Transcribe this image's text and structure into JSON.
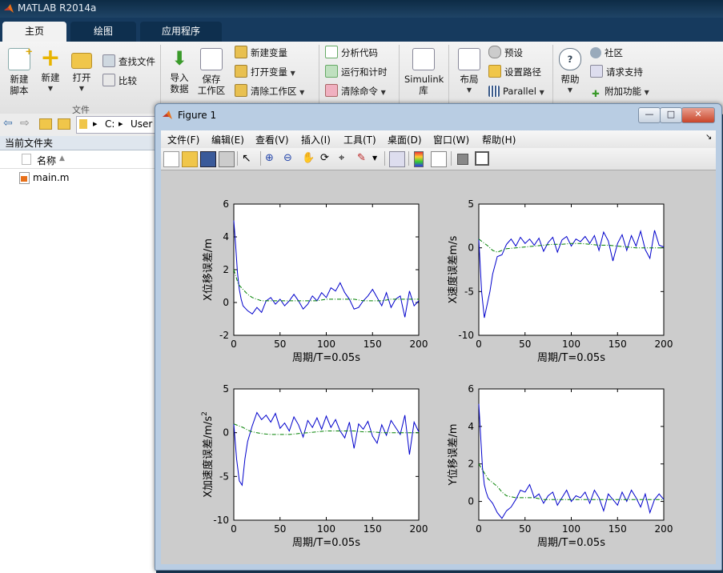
{
  "window": {
    "title": "MATLAB R2014a"
  },
  "main_tabs": [
    "主页",
    "绘图",
    "应用程序"
  ],
  "ribbon": {
    "new_script": "新建\n脚本",
    "new": "新建",
    "open": "打开",
    "find_files": "查找文件",
    "compare": "比较",
    "file_group": "文件",
    "import": "导入\n数据",
    "save_workspace": "保存\n工作区",
    "new_variable": "新建变量",
    "open_variable": "打开变量",
    "clear_workspace": "清除工作区",
    "analyze_code": "分析代码",
    "run_time": "运行和计时",
    "clear_commands": "清除命令",
    "simulink": "Simulink\n库",
    "layout": "布局",
    "preferences": "预设",
    "set_path": "设置路径",
    "parallel": "Parallel",
    "help": "帮助",
    "community": "社区",
    "request_support": "请求支持",
    "addons": "附加功能"
  },
  "path": {
    "drive": "C:",
    "user": "User"
  },
  "current_folder": {
    "header": "当前文件夹",
    "col_name": "名称",
    "files": [
      "main.m"
    ]
  },
  "figure": {
    "title": "Figure 1",
    "menu": [
      "文件(F)",
      "编辑(E)",
      "查看(V)",
      "插入(I)",
      "工具(T)",
      "桌面(D)",
      "窗口(W)",
      "帮助(H)"
    ]
  },
  "colors": {
    "series_measured": "#0000cc",
    "series_filtered": "#008000"
  },
  "chart_data": [
    {
      "type": "line",
      "xlabel": "周期/T=0.05s",
      "ylabel": "X位移误差/m",
      "xlim": [
        0,
        200
      ],
      "ylim": [
        -2,
        6
      ],
      "xticks": [
        0,
        50,
        100,
        150,
        200
      ],
      "yticks": [
        -2,
        0,
        2,
        4,
        6
      ],
      "series": [
        {
          "style": "solid",
          "x": [
            0,
            2,
            4,
            6,
            8,
            10,
            15,
            20,
            25,
            30,
            35,
            40,
            45,
            50,
            55,
            60,
            65,
            70,
            75,
            80,
            85,
            90,
            95,
            100,
            105,
            110,
            115,
            120,
            125,
            130,
            135,
            140,
            145,
            150,
            155,
            160,
            165,
            170,
            175,
            180,
            185,
            190,
            195,
            200
          ],
          "y": [
            5,
            3.5,
            1.8,
            0.8,
            0.2,
            -0.2,
            -0.5,
            -0.7,
            -0.3,
            -0.6,
            0.1,
            0.3,
            -0.1,
            0.2,
            -0.2,
            0.1,
            0.5,
            0.1,
            -0.4,
            -0.1,
            0.4,
            0.1,
            0.6,
            0.3,
            0.9,
            0.7,
            1.2,
            0.6,
            0.2,
            -0.4,
            -0.3,
            0.1,
            0.4,
            0.8,
            0.3,
            -0.2,
            0.6,
            -0.3,
            0.2,
            0.4,
            -0.9,
            0.7,
            -0.2,
            0.1
          ]
        },
        {
          "style": "dash-dot",
          "x": [
            0,
            5,
            10,
            15,
            20,
            25,
            30,
            40,
            50,
            60,
            70,
            80,
            90,
            100,
            110,
            120,
            130,
            140,
            150,
            160,
            170,
            180,
            190,
            200
          ],
          "y": [
            2,
            1.1,
            0.8,
            0.5,
            0.3,
            0.2,
            0.1,
            0.1,
            0.1,
            0.1,
            0.1,
            0.1,
            0.1,
            0.2,
            0.2,
            0.2,
            0.2,
            0.1,
            0.1,
            0.1,
            0.2,
            0.2,
            0.2,
            0.2
          ]
        }
      ]
    },
    {
      "type": "line",
      "xlabel": "周期/T=0.05s",
      "ylabel": "X速度误差m/s",
      "xlim": [
        0,
        200
      ],
      "ylim": [
        -10,
        5
      ],
      "xticks": [
        0,
        50,
        100,
        150,
        200
      ],
      "yticks": [
        -10,
        -5,
        0,
        5
      ],
      "series": [
        {
          "style": "solid",
          "x": [
            0,
            3,
            6,
            9,
            12,
            15,
            20,
            25,
            30,
            35,
            40,
            45,
            50,
            55,
            60,
            65,
            70,
            75,
            80,
            85,
            90,
            95,
            100,
            105,
            110,
            115,
            120,
            125,
            130,
            135,
            140,
            145,
            150,
            155,
            160,
            165,
            170,
            175,
            180,
            185,
            190,
            195,
            200
          ],
          "y": [
            1,
            -5,
            -8,
            -6.5,
            -5,
            -3,
            -1,
            -0.8,
            0.4,
            1,
            0.2,
            1.2,
            0.5,
            1,
            0.3,
            1.1,
            -0.4,
            0.6,
            1.2,
            -0.5,
            0.9,
            1.3,
            0.2,
            1,
            0.7,
            1.3,
            0.5,
            1.4,
            -0.3,
            1.8,
            0.8,
            -1.5,
            0.5,
            1.5,
            -0.3,
            1.4,
            0.2,
            1.9,
            -0.2,
            -1.2,
            2,
            0.3,
            0.1
          ]
        },
        {
          "style": "dash-dot",
          "x": [
            0,
            5,
            10,
            15,
            20,
            25,
            30,
            40,
            50,
            60,
            70,
            80,
            90,
            100,
            110,
            120,
            130,
            140,
            150,
            160,
            170,
            180,
            190,
            200
          ],
          "y": [
            1,
            0.6,
            0.2,
            -0.3,
            -0.5,
            -0.3,
            -0.1,
            0,
            0.1,
            0.2,
            0.3,
            0.4,
            0.4,
            0.5,
            0.5,
            0.4,
            0.3,
            0.3,
            0.2,
            0.1,
            0,
            0,
            0,
            0
          ]
        }
      ]
    },
    {
      "type": "line",
      "xlabel": "周期/T=0.05s",
      "ylabel": "X加速度误差/m/s",
      "ylabel_superscript": "2",
      "xlim": [
        0,
        200
      ],
      "ylim": [
        -10,
        5
      ],
      "xticks": [
        0,
        50,
        100,
        150,
        200
      ],
      "yticks": [
        -10,
        -5,
        0,
        5
      ],
      "series": [
        {
          "style": "solid",
          "x": [
            0,
            3,
            6,
            9,
            12,
            15,
            20,
            25,
            30,
            35,
            40,
            45,
            50,
            55,
            60,
            65,
            70,
            75,
            80,
            85,
            90,
            95,
            100,
            105,
            110,
            115,
            120,
            125,
            130,
            135,
            140,
            145,
            150,
            155,
            160,
            165,
            170,
            175,
            180,
            185,
            190,
            195,
            200
          ],
          "y": [
            1,
            -3,
            -5.5,
            -6,
            -3,
            -1,
            0.8,
            2.3,
            1.5,
            2,
            1.2,
            2.2,
            0.5,
            1.1,
            0.2,
            1.8,
            0.9,
            -0.5,
            1.4,
            0.6,
            1.7,
            0.4,
            1.9,
            0.6,
            1.5,
            0.2,
            -0.6,
            1.2,
            -1.8,
            1,
            0.4,
            1.3,
            -0.4,
            -1.2,
            0.9,
            -0.3,
            1.4,
            0.6,
            -0.2,
            2,
            -2.5,
            1.2,
            0.1
          ]
        },
        {
          "style": "dash-dot",
          "x": [
            0,
            5,
            10,
            15,
            20,
            25,
            30,
            40,
            50,
            60,
            70,
            80,
            90,
            100,
            110,
            120,
            130,
            140,
            150,
            160,
            170,
            180,
            190,
            200
          ],
          "y": [
            1,
            0.8,
            0.6,
            0.3,
            0.1,
            0,
            -0.1,
            -0.2,
            -0.2,
            -0.2,
            -0.1,
            0,
            0.1,
            0.2,
            0.2,
            0.2,
            0.2,
            0.1,
            0.1,
            0,
            0,
            0,
            0,
            0
          ]
        }
      ]
    },
    {
      "type": "line",
      "xlabel": "周期/T=0.05s",
      "ylabel": "Y位移误差/m",
      "xlim": [
        0,
        200
      ],
      "ylim": [
        -1,
        6
      ],
      "xticks": [
        0,
        50,
        100,
        150,
        200
      ],
      "yticks": [
        0,
        2,
        4,
        6
      ],
      "series": [
        {
          "style": "solid",
          "x": [
            0,
            2,
            4,
            6,
            8,
            10,
            15,
            20,
            25,
            30,
            35,
            40,
            45,
            50,
            55,
            60,
            65,
            70,
            75,
            80,
            85,
            90,
            95,
            100,
            105,
            110,
            115,
            120,
            125,
            130,
            135,
            140,
            145,
            150,
            155,
            160,
            165,
            170,
            175,
            180,
            185,
            190,
            195,
            200
          ],
          "y": [
            5.2,
            3.5,
            1.8,
            0.9,
            0.5,
            0.2,
            -0.1,
            -0.6,
            -0.9,
            -0.5,
            -0.3,
            0.1,
            0.6,
            0.5,
            0.9,
            0.2,
            0.4,
            -0.1,
            0.3,
            0.5,
            -0.2,
            0.2,
            0.6,
            0,
            0.3,
            0.2,
            0.5,
            -0.1,
            0.6,
            0.2,
            -0.5,
            0.4,
            0.1,
            -0.2,
            0.5,
            0,
            0.6,
            0.2,
            -0.3,
            0.4,
            -0.6,
            0.1,
            0.4,
            0.1
          ]
        },
        {
          "style": "dash-dot",
          "x": [
            0,
            5,
            10,
            15,
            20,
            25,
            30,
            40,
            50,
            60,
            70,
            80,
            90,
            100,
            110,
            120,
            130,
            140,
            150,
            160,
            170,
            180,
            190,
            200
          ],
          "y": [
            2,
            1.6,
            1.2,
            1,
            0.8,
            0.5,
            0.3,
            0.2,
            0.2,
            0.2,
            0.1,
            0.1,
            0.1,
            0.1,
            0.1,
            0.1,
            0.1,
            0.1,
            0.1,
            0.1,
            0.1,
            0.1,
            0.1,
            0.1
          ]
        }
      ]
    }
  ]
}
